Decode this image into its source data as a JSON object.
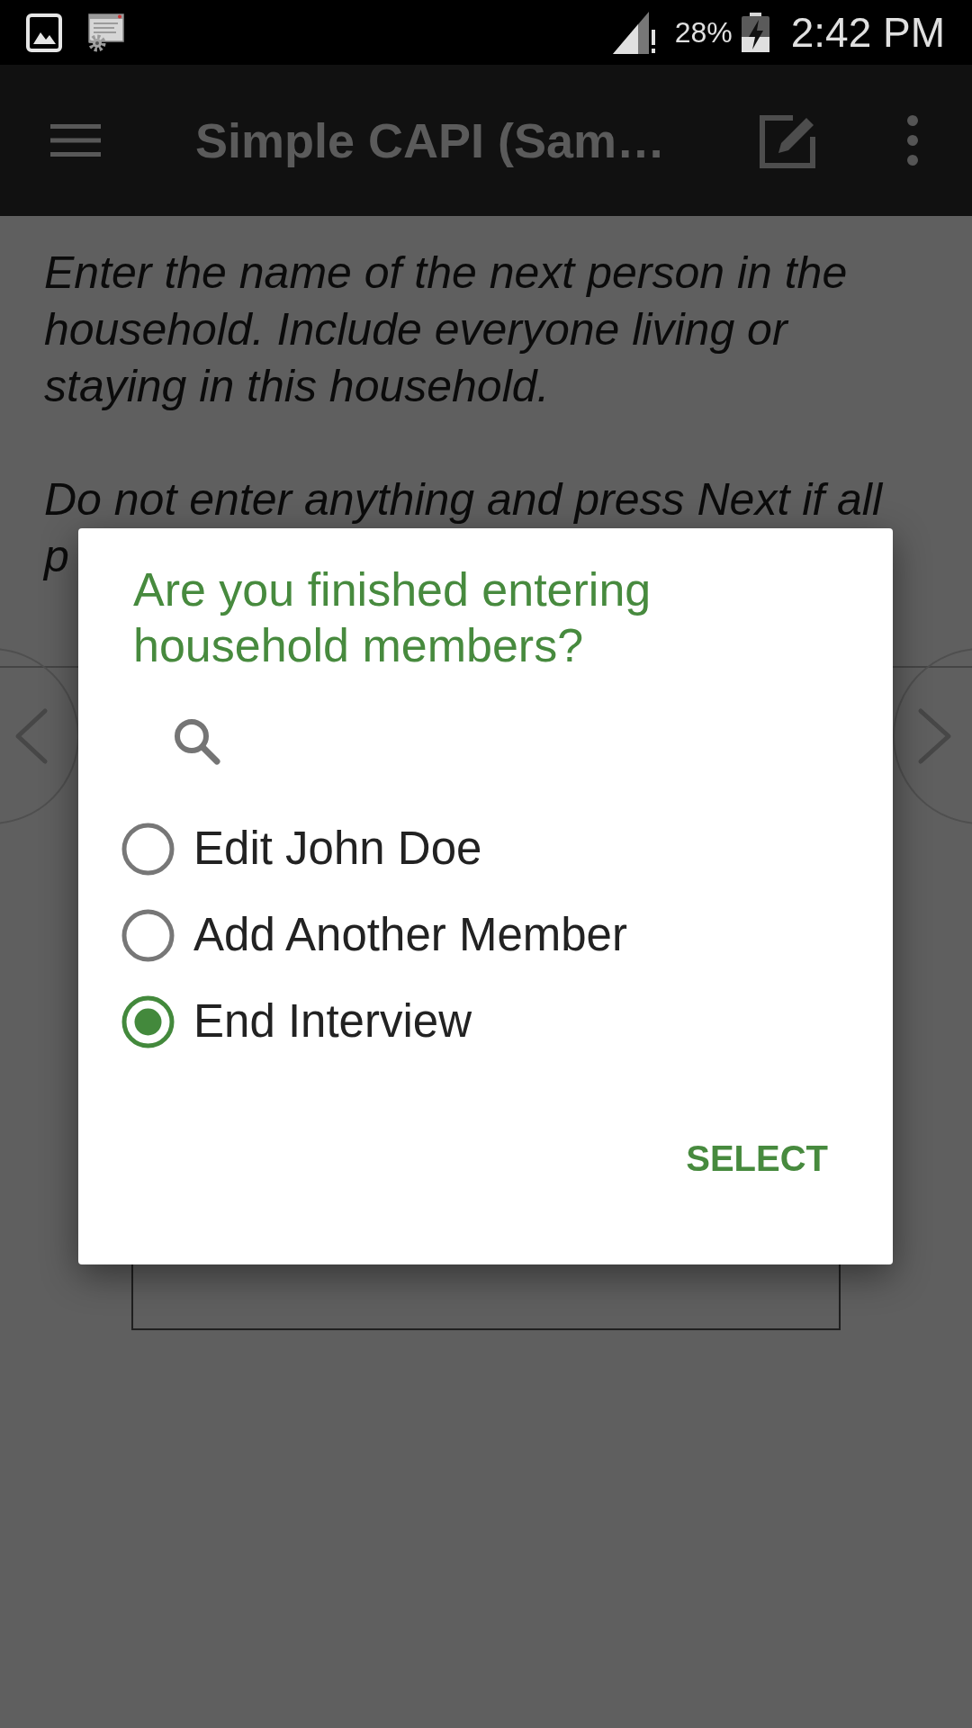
{
  "status_bar": {
    "battery": "28%",
    "time": "2:42 PM"
  },
  "app_bar": {
    "title": "Simple CAPI (Sam…"
  },
  "question": {
    "paragraphs": [
      "Enter the name of the next person in the household. Include everyone living or staying in this household.",
      "Do not enter anything and press Next if all p"
    ]
  },
  "dialog": {
    "title": "Are you finished entering household members?",
    "options": [
      {
        "label": "Edit John Doe",
        "selected": false
      },
      {
        "label": "Add Another Member",
        "selected": false
      },
      {
        "label": "End Interview",
        "selected": true
      }
    ],
    "button": {
      "label": "SELECT"
    }
  }
}
